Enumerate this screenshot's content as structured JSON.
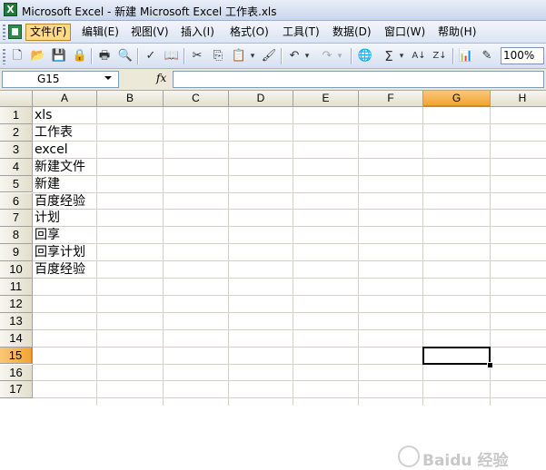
{
  "window": {
    "title": "Microsoft Excel - 新建 Microsoft Excel 工作表.xls"
  },
  "menu": {
    "items": [
      {
        "label": "文件(F)",
        "active": true
      },
      {
        "label": "编辑(E)",
        "active": false
      },
      {
        "label": "视图(V)",
        "active": false
      },
      {
        "label": "插入(I)",
        "active": false
      },
      {
        "label": "格式(O)",
        "active": false
      },
      {
        "label": "工具(T)",
        "active": false
      },
      {
        "label": "数据(D)",
        "active": false
      },
      {
        "label": "窗口(W)",
        "active": false
      },
      {
        "label": "帮助(H)",
        "active": false
      }
    ]
  },
  "toolbar": {
    "zoom": "100%",
    "buttons": [
      "new-icon",
      "open-icon",
      "save-icon",
      "permission-icon",
      "print-icon",
      "print-preview-icon",
      "spelling-icon",
      "research-icon",
      "cut-icon",
      "copy-icon",
      "paste-icon",
      "format-painter-icon",
      "undo-icon",
      "redo-icon",
      "hyperlink-icon",
      "autosum-icon",
      "sort-ascending-icon",
      "sort-descending-icon",
      "chart-wizard-icon",
      "drawing-icon"
    ]
  },
  "formula_bar": {
    "name_box": "G15",
    "fx_label": "fx",
    "formula": ""
  },
  "sheet": {
    "columns": [
      "A",
      "B",
      "C",
      "D",
      "E",
      "F",
      "G",
      "H"
    ],
    "selected_column": "G",
    "selected_row": 15,
    "active_cell": "G15",
    "rows": [
      1,
      2,
      3,
      4,
      5,
      6,
      7,
      8,
      9,
      10,
      11,
      12,
      13,
      14,
      15,
      16,
      17
    ],
    "cells": [
      {
        "ref": "A1",
        "value": "xls"
      },
      {
        "ref": "A2",
        "value": "工作表"
      },
      {
        "ref": "A3",
        "value": "excel"
      },
      {
        "ref": "A4",
        "value": "新建文件"
      },
      {
        "ref": "A5",
        "value": "新建"
      },
      {
        "ref": "A6",
        "value": "百度经验"
      },
      {
        "ref": "A7",
        "value": "计划"
      },
      {
        "ref": "A8",
        "value": "回享"
      },
      {
        "ref": "A9",
        "value": "回享计划"
      },
      {
        "ref": "A10",
        "value": "百度经验"
      }
    ]
  },
  "watermark": "Baidu 经验",
  "colors": {
    "selection_header": "#f1a536",
    "gridline": "#d4d0c8",
    "menu_active": "#ffd98a"
  }
}
